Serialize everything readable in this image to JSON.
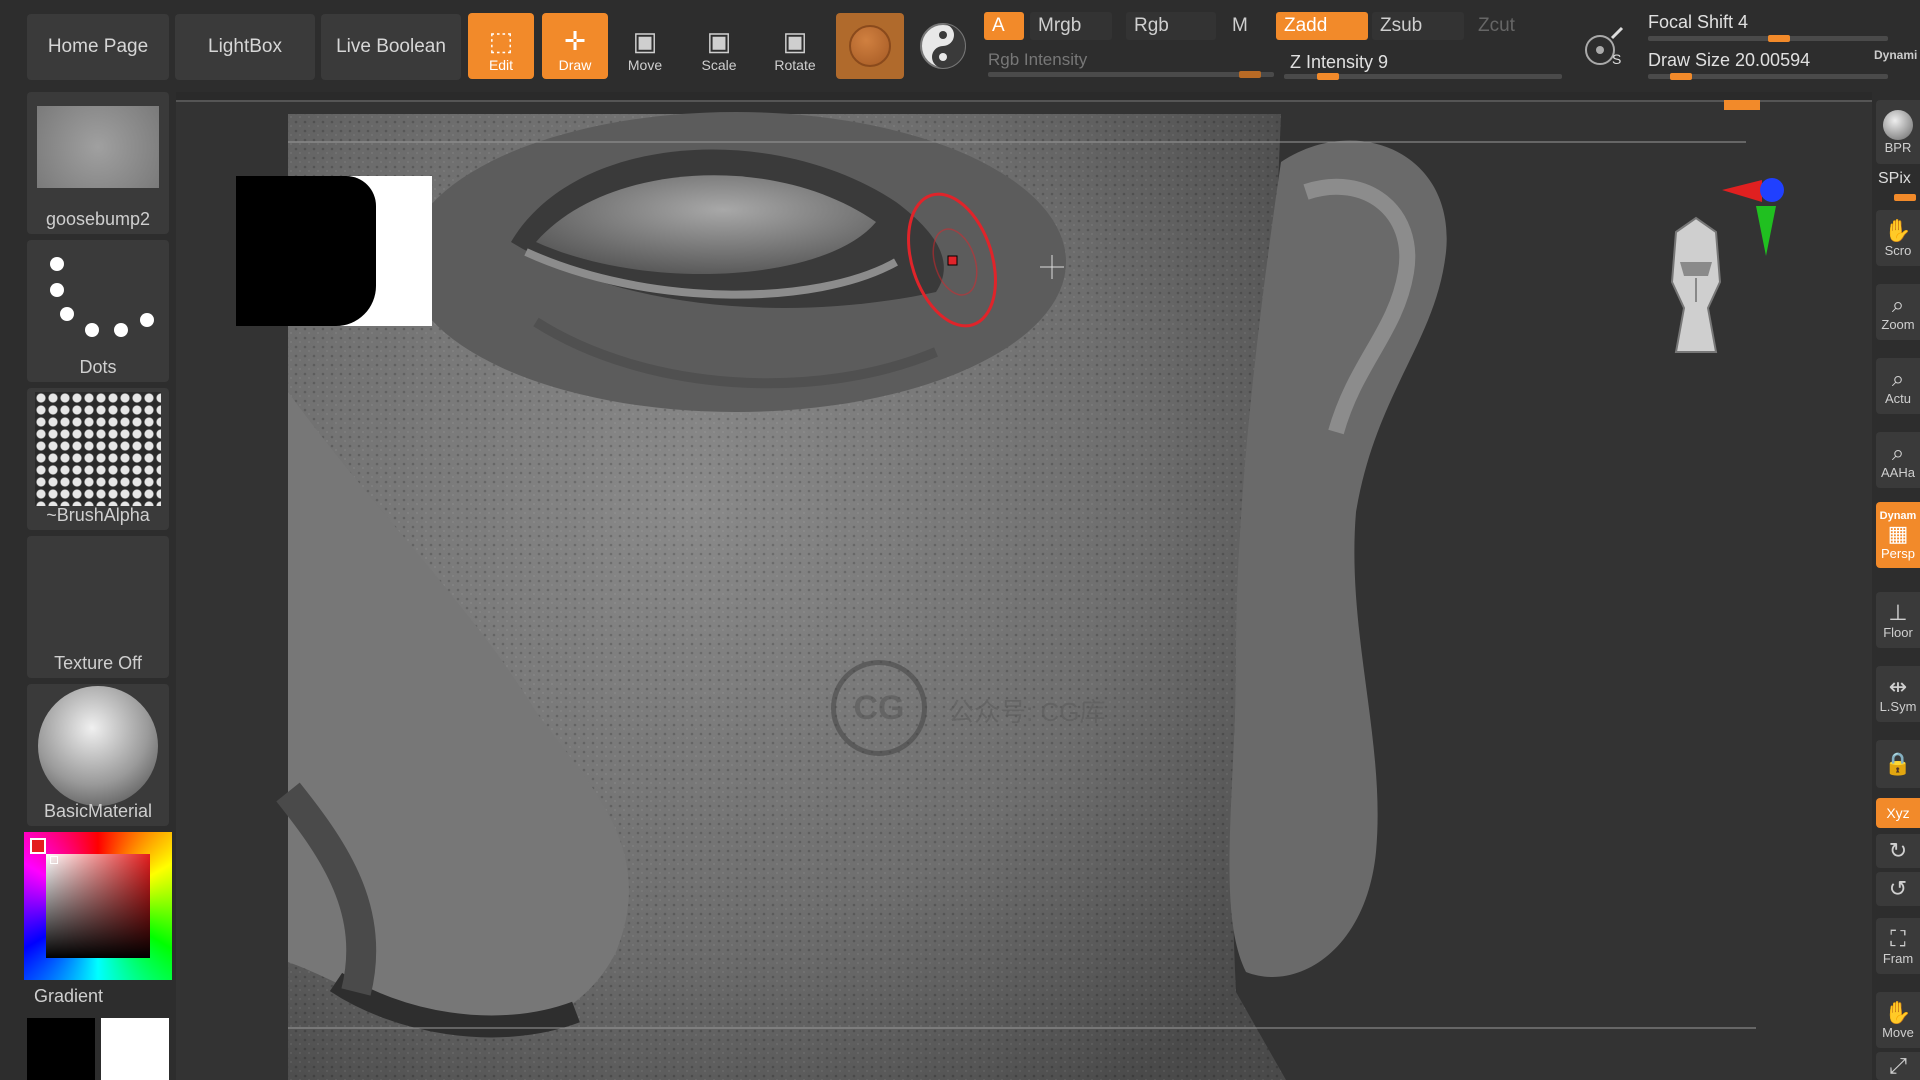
{
  "nav": {
    "home_label": "Home Page",
    "lightbox_label": "LightBox",
    "live_boolean_label": "Live Boolean"
  },
  "tools": {
    "edit_label": "Edit",
    "draw_label": "Draw",
    "move_label": "Move",
    "scale_label": "Scale",
    "rotate_label": "Rotate"
  },
  "color_modes": {
    "a_label": "A",
    "mrgb_label": "Mrgb",
    "rgb_label": "Rgb",
    "m_label": "M",
    "rgb_intensity_label": "Rgb Intensity"
  },
  "z_modes": {
    "zadd_label": "Zadd",
    "zsub_label": "Zsub",
    "zcut_label": "Zcut",
    "z_intensity_label": "Z Intensity 9"
  },
  "brush_settings": {
    "focal_shift_label": "Focal Shift 4",
    "draw_size_label": "Draw Size 20.00594",
    "dynamic_label": "Dynami"
  },
  "left_shelf": {
    "brush_label": "goosebump2",
    "stroke_label": "Dots",
    "alpha_label": "~BrushAlpha",
    "texture_label": "Texture Off",
    "material_label": "BasicMaterial",
    "gradient_label": "Gradient"
  },
  "right_shelf": {
    "bpr_label": "BPR",
    "spix_label": "SPix",
    "scroll_label": "Scro",
    "zoom_label": "Zoom",
    "actual_label": "Actu",
    "aahalf_label": "AAHa",
    "dynamic_label": "Dynam",
    "persp_label": "Persp",
    "floor_label": "Floor",
    "lsym_label": "L.Sym",
    "xyz_label": "Xyz",
    "frame_label": "Fram",
    "move_label": "Move"
  },
  "watermark": {
    "logo_text": "CG",
    "text": "公众号: CG库"
  },
  "colors": {
    "accent": "#f28a2a",
    "panel": "#2d2d2d",
    "button": "#3a3a3a",
    "brush_ring": "#e0242a"
  },
  "slider_levels": {
    "rgb_intensity": 0.95,
    "z_intensity": 0.13,
    "focal_shift": 0.55,
    "draw_size": 0.1
  }
}
